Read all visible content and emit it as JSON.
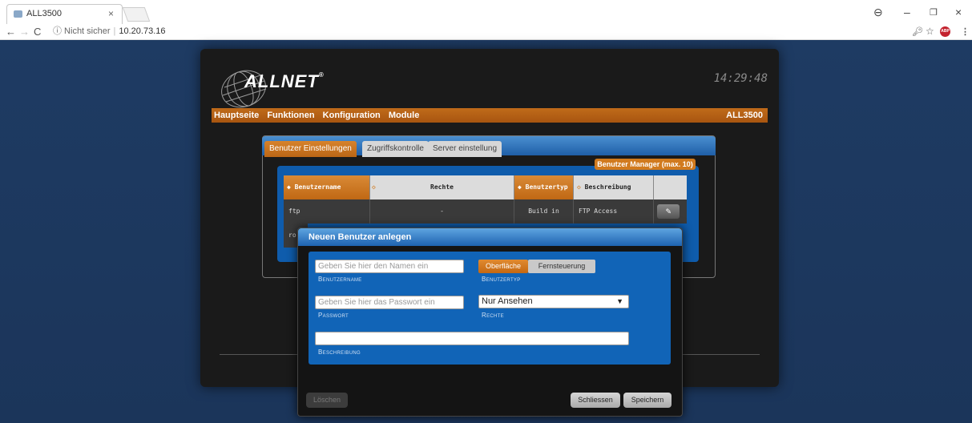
{
  "browser": {
    "tab_title": "ALL3500",
    "tab_close": "×",
    "security": "ⓘ Nicht sicher",
    "url": "10.20.73.16",
    "window_controls": [
      "–",
      "❐",
      "×"
    ]
  },
  "device": {
    "logo": "ALLNET",
    "logo_reg": "®",
    "clock": "14:29:48",
    "menu": [
      "Hauptseite",
      "Funktionen",
      "Konfiguration",
      "Module"
    ],
    "model": "ALL3500"
  },
  "tabs": [
    "Benutzer Einstellungen",
    "Zugriffskontrolle",
    "Server einstellung"
  ],
  "user_manager_label": "Benutzer Manager (max. 10)",
  "table": {
    "headers": [
      "Benutzername",
      "Rechte",
      "Benutzertyp",
      "Beschreibung"
    ],
    "rows": [
      {
        "name": "ftp",
        "rights": "-",
        "type": "Build in",
        "description": "FTP Access"
      }
    ],
    "partial_row": "ro"
  },
  "dialog": {
    "title": "Neuen Benutzer anlegen",
    "username_placeholder": "Geben Sie hier den Namen ein",
    "username_label": "Benutzername",
    "usertype_options": [
      "Oberfläche",
      "Fernsteuerung"
    ],
    "usertype_selected": "Oberfläche",
    "usertype_label": "Benutzertyp",
    "password_placeholder": "Geben Sie hier das Passwort ein",
    "password_label": "Passwort",
    "rights_value": "Nur Ansehen",
    "rights_label": "Rechte",
    "description_value": "",
    "description_label": "Beschreibung",
    "buttons": {
      "delete": "Löschen",
      "close": "Schliessen",
      "save": "Speichern"
    }
  },
  "colors": {
    "accent_orange": "#c06b1a",
    "accent_blue": "#1164b7",
    "background": "#1d3a62"
  }
}
